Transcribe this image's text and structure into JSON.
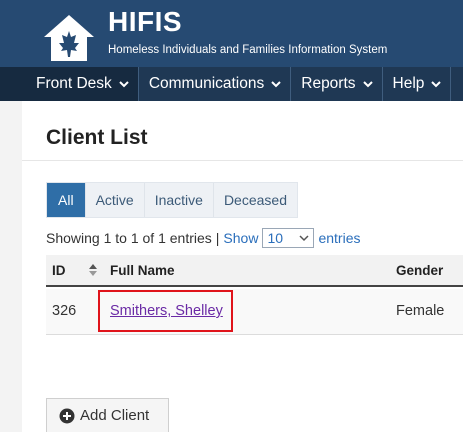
{
  "header": {
    "brand": "HIFIS",
    "subtitle": "Homeless Individuals and Families Information System",
    "logo_icon": "maple-leaf-house-icon"
  },
  "nav": {
    "items": [
      {
        "label": "Front Desk"
      },
      {
        "label": "Communications"
      },
      {
        "label": "Reports"
      },
      {
        "label": "Help"
      }
    ]
  },
  "page": {
    "title": "Client List"
  },
  "tabs": {
    "items": [
      {
        "label": "All",
        "active": true
      },
      {
        "label": "Active"
      },
      {
        "label": "Inactive"
      },
      {
        "label": "Deceased"
      }
    ]
  },
  "table_info": {
    "showing": "Showing 1 to 1 of 1 entries",
    "separator": "|",
    "show_label": "Show",
    "page_size": "10",
    "entries_label": "entries"
  },
  "table": {
    "columns": [
      "ID",
      "Full Name",
      "Gender"
    ],
    "rows": [
      {
        "id": "326",
        "full_name": "Smithers, Shelley",
        "gender": "Female"
      }
    ]
  },
  "actions": {
    "add_client": "Add Client"
  },
  "colors": {
    "header_bg": "#264a72",
    "nav_bg": "#1f3854",
    "active_tab": "#2f6ea7",
    "highlight": "#e0141b",
    "link": "#6a2aa5"
  }
}
